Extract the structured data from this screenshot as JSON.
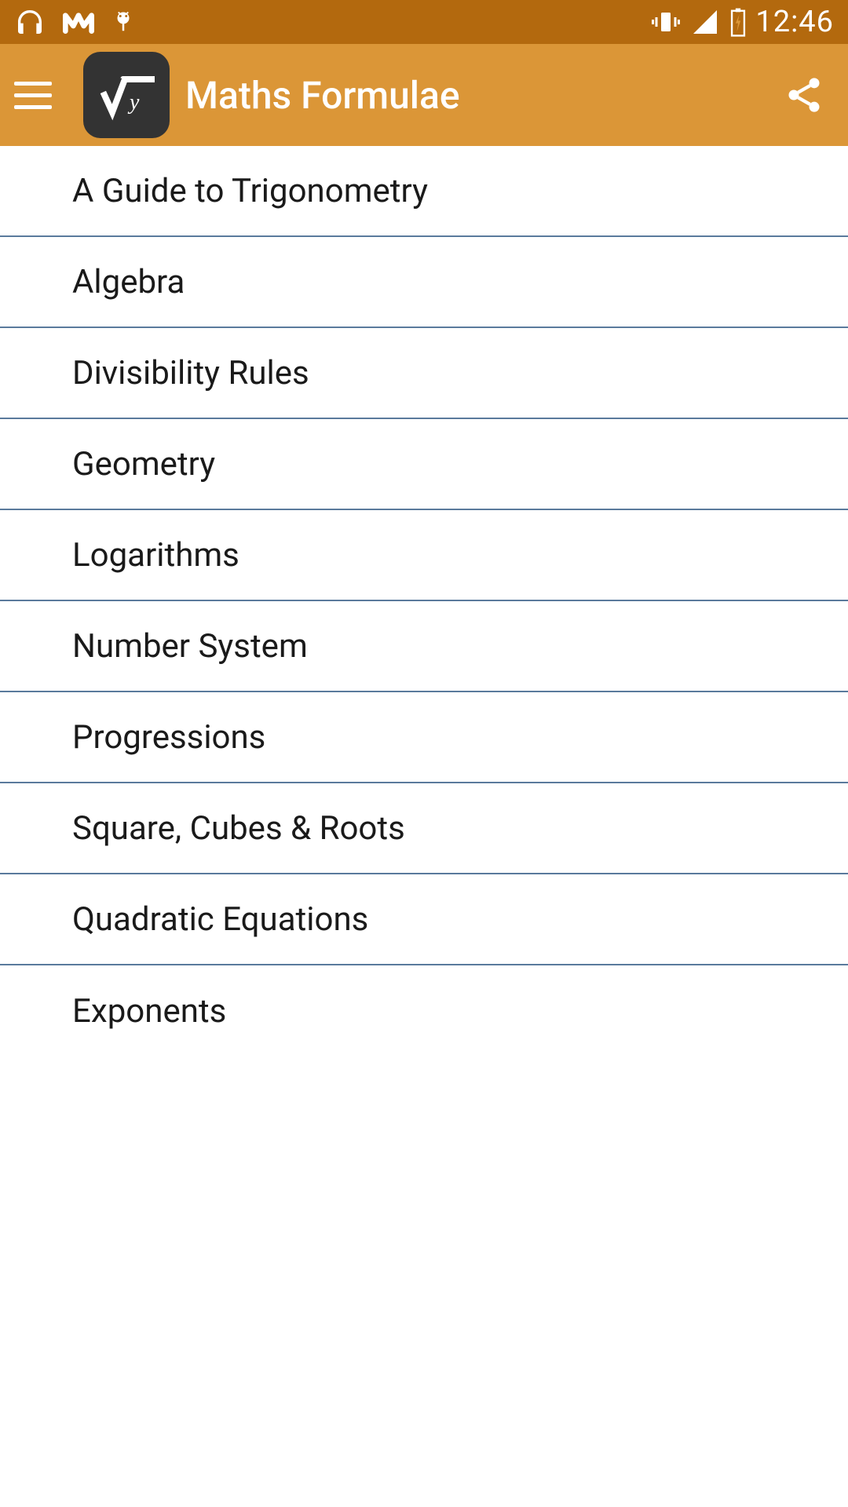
{
  "statusBar": {
    "time": "12:46"
  },
  "appBar": {
    "title": "Maths Formulae"
  },
  "list": {
    "items": [
      {
        "label": "A Guide to Trigonometry"
      },
      {
        "label": "Algebra"
      },
      {
        "label": "Divisibility Rules"
      },
      {
        "label": "Geometry"
      },
      {
        "label": "Logarithms"
      },
      {
        "label": "Number System"
      },
      {
        "label": "Progressions"
      },
      {
        "label": "Square, Cubes & Roots"
      },
      {
        "label": "Quadratic Equations"
      },
      {
        "label": "Exponents"
      }
    ]
  }
}
